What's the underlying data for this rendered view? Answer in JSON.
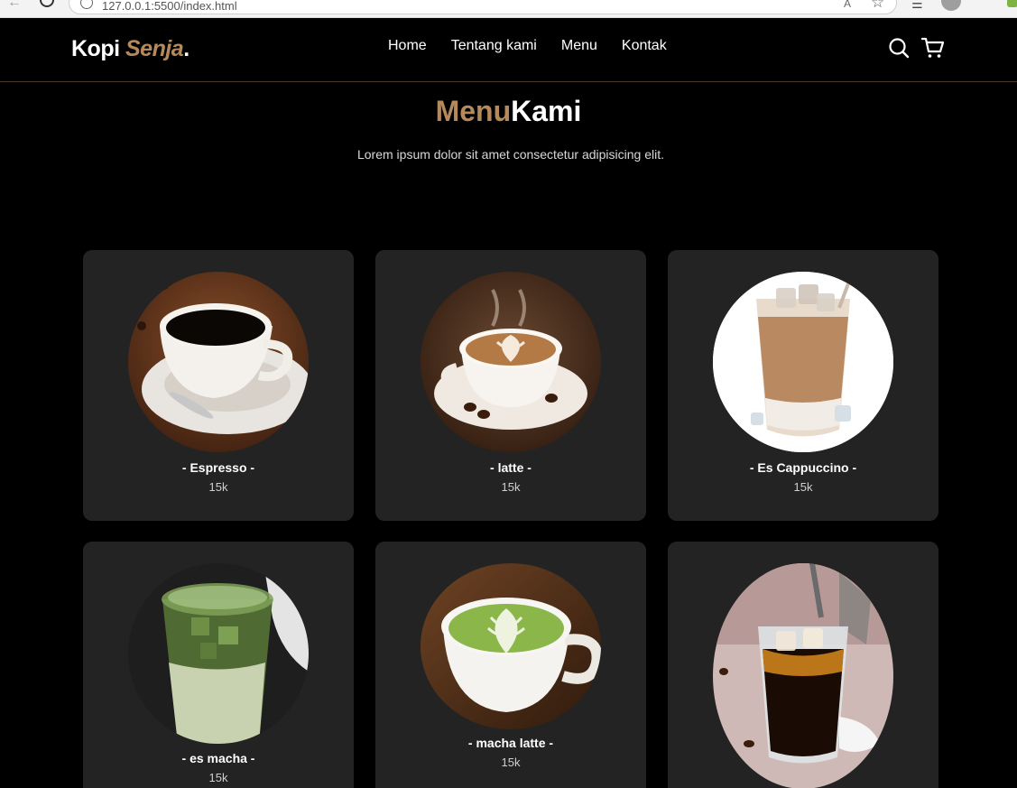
{
  "browser": {
    "url": "127.0.0.1:5500/index.html"
  },
  "navbar": {
    "logo_main": "Kopi ",
    "logo_accent": "Senja",
    "logo_dot": ".",
    "links": [
      "Home",
      "Tentang kami",
      "Menu",
      "Kontak"
    ]
  },
  "menu": {
    "title_accent": "Menu",
    "title_main": "Kami",
    "description": "Lorem ipsum dolor sit amet consectetur adipisicing elit.",
    "items": [
      {
        "name": "- Espresso -",
        "price": "15k",
        "icon": "espresso-cup-image"
      },
      {
        "name": "- latte -",
        "price": "15k",
        "icon": "latte-art-image"
      },
      {
        "name": "- Es Cappuccino -",
        "price": "15k",
        "icon": "iced-cappuccino-image"
      },
      {
        "name": "- es macha -",
        "price": "15k",
        "icon": "iced-matcha-image"
      },
      {
        "name": "- macha latte -",
        "price": "15k",
        "icon": "matcha-latte-image"
      },
      {
        "name": "",
        "price": "",
        "icon": "iced-black-coffee-image"
      }
    ]
  },
  "colors": {
    "accent": "#b6895b",
    "background": "#000000",
    "card": "#232323"
  }
}
